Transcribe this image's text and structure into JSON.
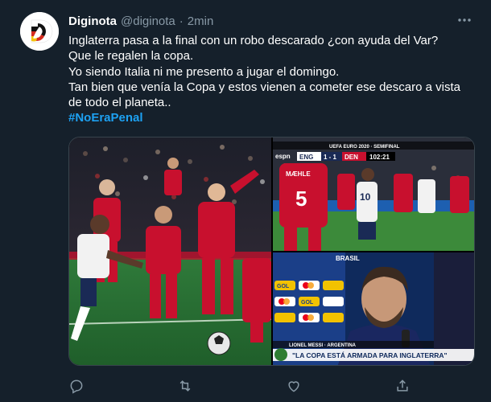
{
  "tweet": {
    "author_name": "Diginota",
    "author_handle": "@diginota",
    "separator": "·",
    "timestamp": "2min",
    "lines": [
      "Inglaterra pasa a la final con un robo descarado  ¿con ayuda del Var?",
      "Que le regalen la copa.",
      "Yo siendo Italia ni me presento a jugar el domingo.",
      "Tan bien que venía la Copa y estos vienen a cometer ese descaro a vista",
      "de todo el planeta.."
    ],
    "hashtag": "#NoEraPenal"
  },
  "media": {
    "broadcast_logo": "espn",
    "competition": "UEFA EURO 2020 · SEMIFINAL",
    "home_team": "ENG",
    "score": "1 - 1",
    "away_team": "DEN",
    "clock": "102:21",
    "player_name_shirt": "MÆHLE",
    "player_number": "5",
    "venue_text": "BRASIL",
    "interview_name": "LIONEL MESSI · ARGENTINA",
    "interview_caption": "\"LA COPA ESTÁ ARMADA PARA INGLATERRA\"",
    "ad_text": "GOL"
  },
  "actions": [
    {
      "name": "reply",
      "icon": "reply-icon"
    },
    {
      "name": "retweet",
      "icon": "retweet-icon"
    },
    {
      "name": "like",
      "icon": "heart-icon"
    },
    {
      "name": "share",
      "icon": "share-icon"
    }
  ],
  "colors": {
    "background": "#15202b",
    "secondary_text": "#8899a6",
    "link": "#1da1f2",
    "denmark_red": "#c8102e"
  }
}
